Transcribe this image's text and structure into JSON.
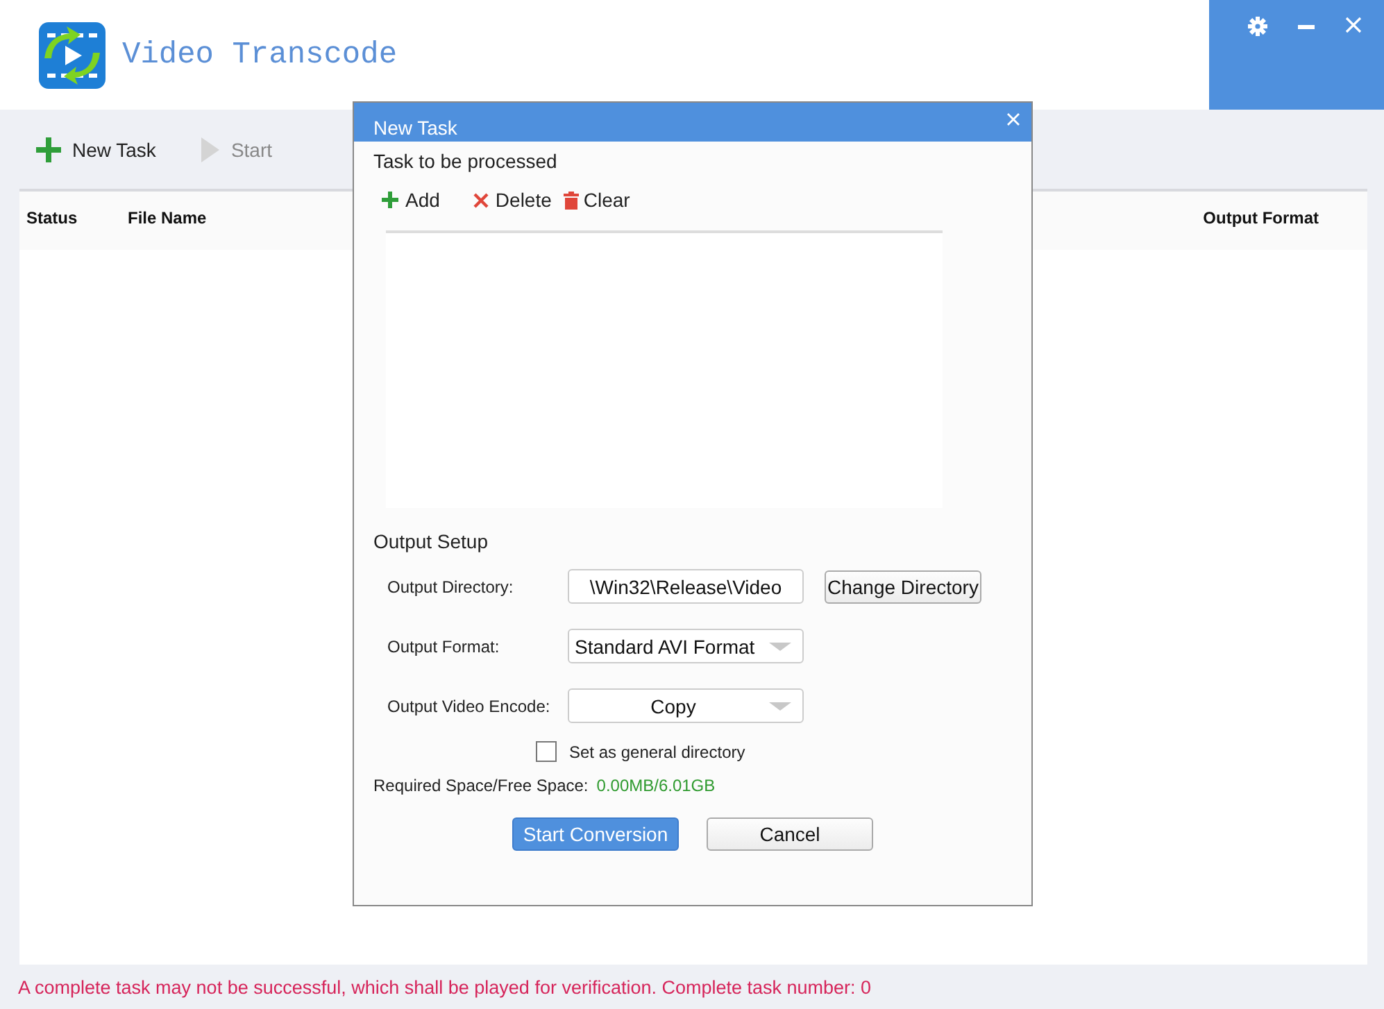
{
  "app": {
    "title": "Video Transcode"
  },
  "toolbar": [
    {
      "label": "New Task",
      "kind": "add",
      "disabled": false
    },
    {
      "label": "Start",
      "kind": "play",
      "disabled": true
    }
  ],
  "table": {
    "columns": [
      "Status",
      "File Name",
      "Output Format"
    ]
  },
  "status_bar": "A complete task may not be successful, which shall be played for verification. Complete task number: 0",
  "dialog": {
    "title": "New Task",
    "section": "Task to be processed",
    "actions": [
      {
        "label": "Add",
        "kind": "add"
      },
      {
        "label": "Delete",
        "kind": "delete"
      },
      {
        "label": "Clear",
        "kind": "clear"
      }
    ],
    "output_title": "Output Setup",
    "fields": [
      {
        "label": "Output Directory:",
        "kind": "text",
        "value": "\\Win32\\Release\\Video",
        "button": "Change Directory"
      },
      {
        "label": "Output Format:",
        "kind": "select",
        "value": "Standard AVI Format",
        "centered": false
      },
      {
        "label": "Output Video Encode:",
        "kind": "select",
        "value": "Copy",
        "centered": true
      }
    ],
    "checkbox": {
      "label": "Set as general directory",
      "checked": false
    },
    "space_label": "Required Space/Free Space:",
    "space_value": "0.00MB/6.01GB",
    "buttons": [
      {
        "label": "Start Conversion",
        "primary": true
      },
      {
        "label": "Cancel",
        "primary": false
      }
    ]
  }
}
